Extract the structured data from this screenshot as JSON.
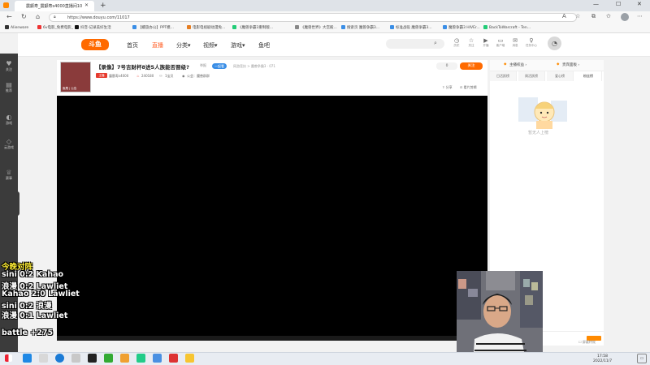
{
  "browser": {
    "tab_title": "震颤寿_震颤寿s4000直播间10",
    "url": "https://www.douyu.com/11017",
    "bookmarks": [
      {
        "label": "Alienware",
        "color": "#333"
      },
      {
        "label": "6v电影_免费电影_",
        "color": "#e33"
      },
      {
        "label": "抖音-记录美好生活",
        "color": "#111"
      },
      {
        "label": "【螺旋办公】PPT模...",
        "color": "#3a8ee6"
      },
      {
        "label": "电影电视剧动漫免...",
        "color": "#e67e22"
      },
      {
        "label": "《魔兽争霸3重制版...",
        "color": "#2c7"
      },
      {
        "label": "《魔兽世界》大宫殿...",
        "color": "#888"
      },
      {
        "label": "搜索页 魔兽争霸3...",
        "color": "#3a8ee6"
      },
      {
        "label": "标准战役 魔兽争霸3...",
        "color": "#3a8ee6"
      },
      {
        "label": "魔兽争霸3 HIVEr...",
        "color": "#3a8ee6"
      },
      {
        "label": "BackToWarcraft - Ten...",
        "color": "#2c7"
      }
    ]
  },
  "site": {
    "logo_text": "斗鱼",
    "nav": [
      "首页",
      "直播",
      "分类▾",
      "视频▾",
      "游戏▾",
      "鱼吧"
    ],
    "header_icons": [
      {
        "icon": "history-icon",
        "label": "历史"
      },
      {
        "icon": "follow-icon",
        "label": "关注"
      },
      {
        "icon": "broadcast-icon",
        "label": "开播"
      },
      {
        "icon": "customer-icon",
        "label": "客户端"
      },
      {
        "icon": "message-icon",
        "label": "消息"
      },
      {
        "icon": "task-icon",
        "label": "任务中心"
      }
    ],
    "left_rail": [
      {
        "icon": "♥",
        "label": "关注"
      },
      {
        "icon": "▤",
        "label": "推荐"
      },
      {
        "icon": "◐",
        "label": "游戏"
      },
      {
        "icon": "◇",
        "label": "云游戏"
      },
      {
        "icon": "♕",
        "label": "赛事"
      }
    ]
  },
  "room": {
    "title": "【录像】7号吉财杯8进5人族能否晋级?",
    "report": "举报",
    "pill": "一起看",
    "breadcrumb": "网游竞技 > 魔兽争霸3 · 071",
    "level_badge": "主播",
    "streamer": "震颤寿s4000",
    "heat": "240180",
    "followers": "1宝贝",
    "notice": "公会：魔兽群群",
    "follow_label": "关注",
    "follow_count": "0",
    "share": "分享",
    "clip": "看片剪辑",
    "anchor_caption": "鱼鹰  | 公告"
  },
  "right_panel": {
    "header": [
      "主播权益 ›",
      "贵宾面板 ›"
    ],
    "tabs": [
      "日活跃榜",
      "周活跃榜",
      "爱心榜",
      "粉丝榜"
    ],
    "active_tab": 3,
    "mascot_text": "暂无人上榜",
    "checkbox_label": "屏蔽特效"
  },
  "overlay": {
    "lines": [
      {
        "text": "今晚对阵",
        "color": "yellow"
      },
      {
        "text": "sini 0:2 Kahao",
        "color": "white"
      },
      {
        "text": "浪漫 0:2 Lawliet",
        "color": "white"
      },
      {
        "text": "Kahao 2:0 Lawliet",
        "color": "white"
      },
      {
        "text": "sini 0:2 浪漫",
        "color": "white"
      },
      {
        "text": "浪漫 0:1 Lawliet",
        "color": "white"
      },
      {
        "text": "battle +275",
        "color": "white"
      }
    ]
  },
  "taskbar": {
    "time": "17:58",
    "date": "2022/11/7"
  }
}
